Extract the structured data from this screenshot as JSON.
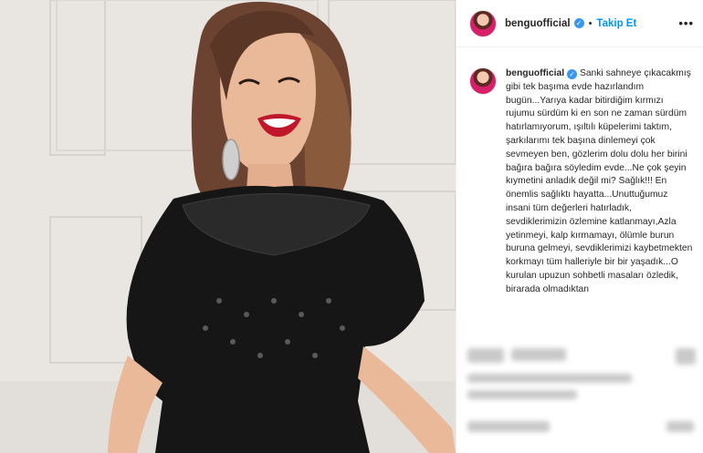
{
  "post": {
    "username": "benguofficial",
    "follow_label": "Takip Et",
    "separator": "•",
    "more_label": "•••",
    "verified_mark": "✓",
    "caption": "Sanki sahneye çıkacakmış gibi tek başıma evde hazırlandım bugün...Yarıya kadar bitirdiğim kırmızı rujumu sürdüm ki en son ne zaman sürdüm hatırlamıyorum, ışıltılı küpelerimi taktım, şarkılarımı tek başına dinlemeyi çok sevmeyen ben, gözlerim dolu dolu her birini bağıra bağıra söyledim evde...Ne çok şeyin kıymetini anladık değil mi? Sağlık!!! En önemlis sağlıktı hayatta...Unuttuğumuz insani tüm değerleri hatırladık, sevdiklerimizin özlemine katlanmayı,Azla yetinmeyi, kalp kırmamayı, ölümle burun buruna gelmeyi, sevdiklerimizi kaybetmekten korkmayı tüm halleriyle bir bir yaşadık...O kurulan upuzun sohbetli masaları özledik, birarada olmadıktan"
  },
  "icons": {
    "avatar": "profile-avatar",
    "verified": "verified-badge-icon",
    "more": "more-options-icon"
  },
  "colors": {
    "accent": "#0095f6",
    "verified": "#3897f0",
    "text": "#262626",
    "lipstick": "#c0182a",
    "dress": "#161616"
  }
}
